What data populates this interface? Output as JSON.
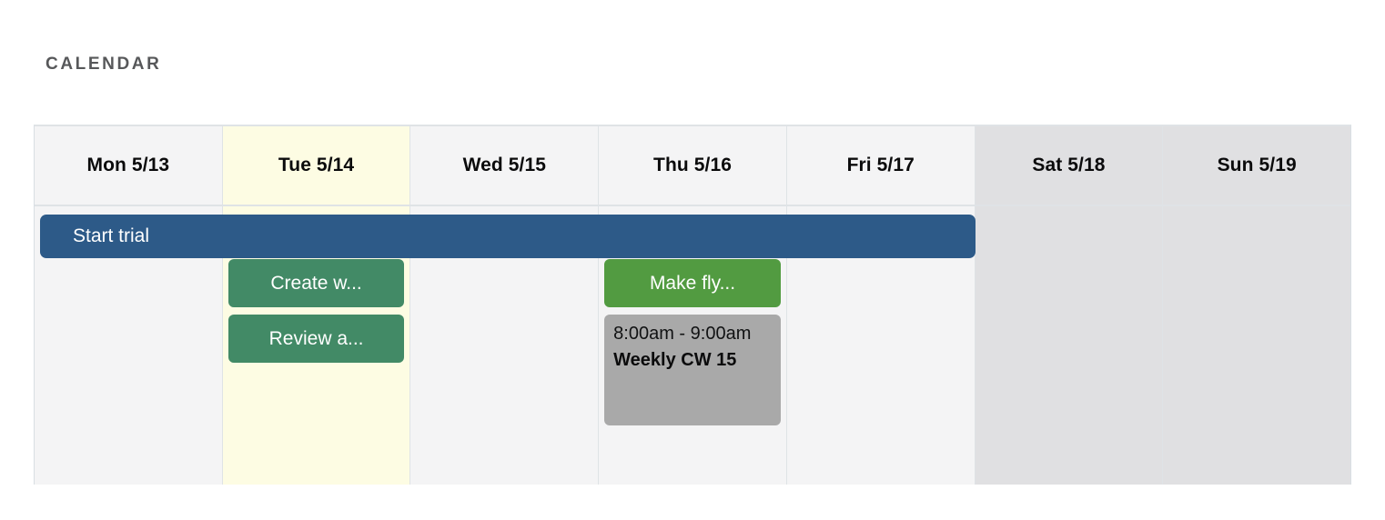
{
  "page_title": "CALENDAR",
  "theme": {
    "weekday_cell_bg": "#f4f4f5",
    "today_cell_bg": "#fdfce3",
    "weekend_cell_bg": "#e0e0e2",
    "grid_border": "#dfe3e6",
    "title_color": "#57585a"
  },
  "calendar": {
    "columns": [
      {
        "label": "Mon 5/13",
        "is_today": false,
        "is_weekend": false
      },
      {
        "label": "Tue 5/14",
        "is_today": true,
        "is_weekend": false
      },
      {
        "label": "Wed 5/15",
        "is_today": false,
        "is_weekend": false
      },
      {
        "label": "Thu 5/16",
        "is_today": false,
        "is_weekend": false
      },
      {
        "label": "Fri 5/17",
        "is_today": false,
        "is_weekend": false
      },
      {
        "label": "Sat 5/18",
        "is_today": false,
        "is_weekend": true
      },
      {
        "label": "Sun 5/19",
        "is_today": false,
        "is_weekend": true
      }
    ],
    "allday_events": [
      {
        "title": "Start trial",
        "color": "#2d5a88",
        "start_column": "Mon 5/13",
        "end_column": "Fri 5/17",
        "span_columns": 5
      }
    ],
    "day_events": {
      "Mon 5/13": [],
      "Tue 5/14": [
        {
          "title": "Create w...",
          "color": "#428a66",
          "text_color": "#ffffff",
          "style": "chip"
        },
        {
          "title": "Review a...",
          "color": "#428a66",
          "text_color": "#ffffff",
          "style": "chip"
        }
      ],
      "Wed 5/15": [],
      "Thu 5/16": [
        {
          "title": "Make fly...",
          "color": "#529b41",
          "text_color": "#ffffff",
          "style": "chip"
        },
        {
          "title": "Weekly CW 15",
          "time": "8:00am - 9:00am",
          "color": "#a9a9a9",
          "text_color": "#111213",
          "style": "detail"
        }
      ],
      "Fri 5/17": [],
      "Sat 5/18": [],
      "Sun 5/19": []
    }
  }
}
